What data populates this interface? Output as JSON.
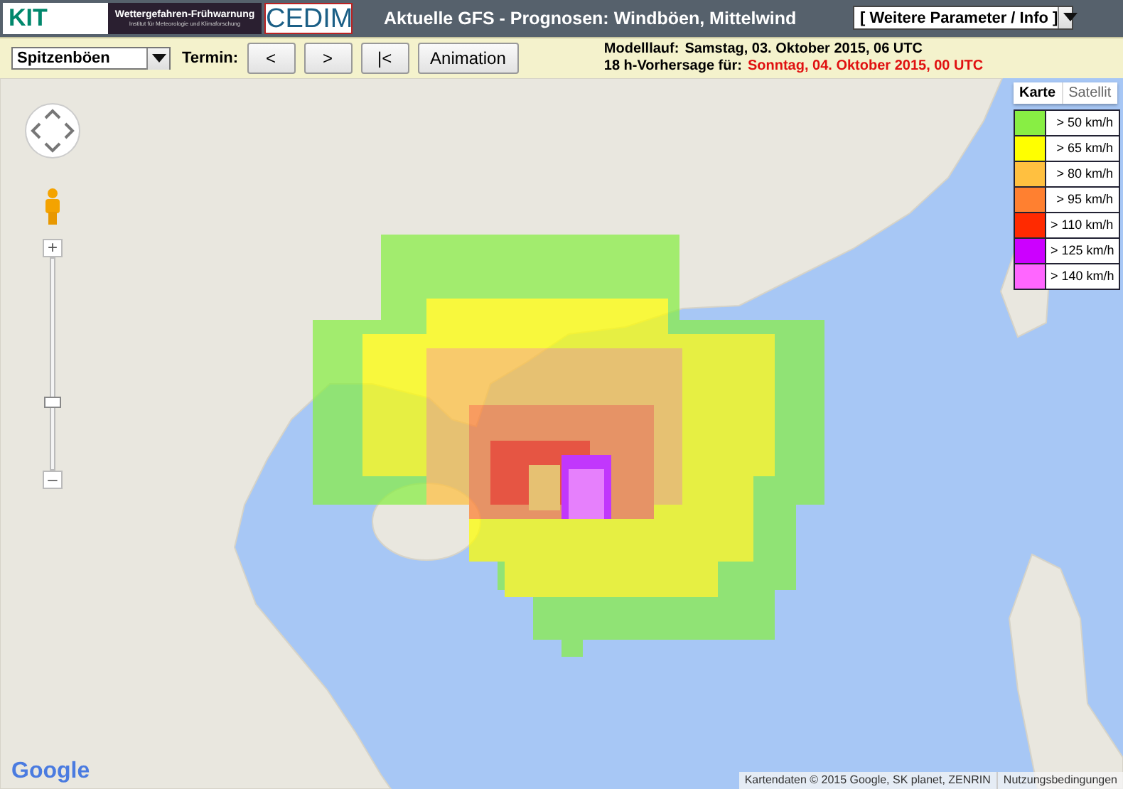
{
  "header": {
    "kit_logo": "KIT",
    "banner": {
      "title": "Wettergefahren-Frühwarnung",
      "subtitle": "Institut für Meteorologie und Klimaforschung"
    },
    "cedim_logo": "CEDIM",
    "title": "Aktuelle GFS - Prognosen: Windböen, Mittelwind",
    "info_dropdown": "[ Weitere Parameter / Info ]"
  },
  "toolbar": {
    "parameter_select": "Spitzenböen",
    "termin_label": "Termin:",
    "buttons": [
      "<",
      ">",
      "|<",
      "Animation"
    ],
    "model_run": {
      "label": "Modelllauf:",
      "value": "Samstag, 03. Oktober 2015, 06 UTC"
    },
    "forecast": {
      "label": "18 h-Vorhersage für:",
      "value": "Sonntag, 04. Oktober 2015, 00 UTC"
    }
  },
  "map": {
    "map_types": [
      {
        "label": "Karte",
        "selected": true
      },
      {
        "label": "Satellit",
        "selected": false
      }
    ],
    "legend": [
      {
        "label": "> 50 km/h",
        "color": "#88ee44"
      },
      {
        "label": "> 65 km/h",
        "color": "#ffff00"
      },
      {
        "label": "> 80 km/h",
        "color": "#ffc040"
      },
      {
        "label": "> 95 km/h",
        "color": "#ff8030"
      },
      {
        "label": "> 110 km/h",
        "color": "#ff2a00"
      },
      {
        "label": "> 125 km/h",
        "color": "#cc00ff"
      },
      {
        "label": "> 140 km/h",
        "color": "#ff66ff"
      }
    ],
    "zoom": {
      "zoom_in": "+",
      "zoom_out": "–",
      "level": 0.33
    },
    "logo": "Google",
    "attribution": "Kartendaten © 2015 Google, SK planet, ZENRIN",
    "terms_link": "Nutzungsbedingungen"
  }
}
